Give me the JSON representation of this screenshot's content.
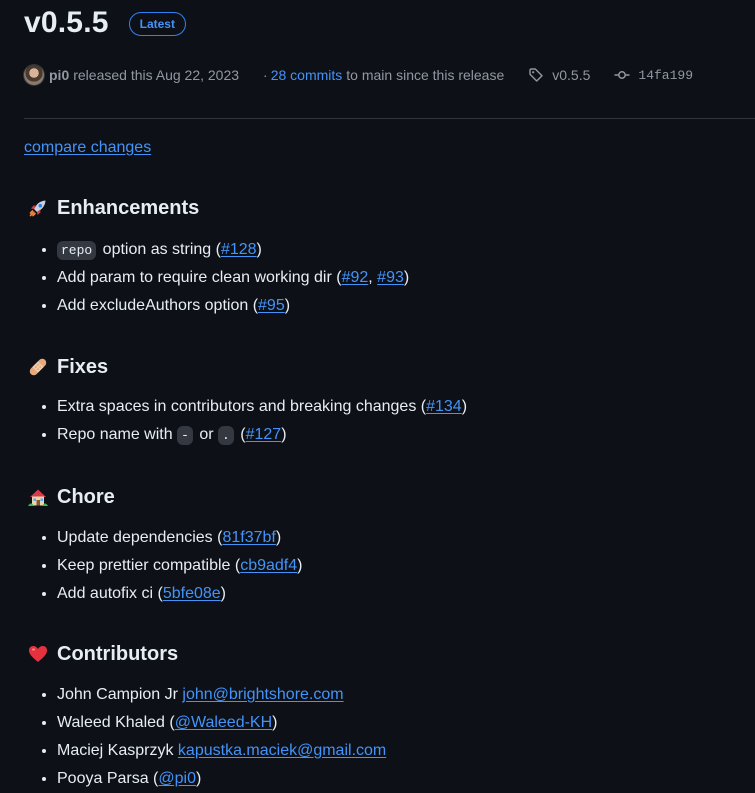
{
  "release": {
    "version": "v0.5.5",
    "badge": "Latest",
    "author": "pi0",
    "released_text": "released this Aug 22, 2023",
    "commits_sep": "·",
    "commits_link": "28 commits",
    "commits_suffix": "to main since this release",
    "tag": "v0.5.5",
    "commit_hash": "14fa199"
  },
  "body": {
    "compare_link": "compare changes",
    "sections": [
      {
        "title": "Enhancements",
        "icon": "rocket-icon",
        "items": [
          {
            "code": "repo",
            "text": " option as string (",
            "links": [
              "#128"
            ],
            "end": ")"
          },
          {
            "text": "Add param to require clean working dir (",
            "links": [
              "#92",
              "#93"
            ],
            "end": ")"
          },
          {
            "text": "Add excludeAuthors option (",
            "links": [
              "#95"
            ],
            "end": ")"
          }
        ]
      },
      {
        "title": "Fixes",
        "icon": "bandage-icon",
        "items": [
          {
            "text": "Extra spaces in contributors and breaking changes (",
            "links": [
              "#134"
            ],
            "end": ")"
          },
          {
            "text": "Repo name with ",
            "code1": "-",
            "mid": " or ",
            "code2": ".",
            "text2": " (",
            "links": [
              "#127"
            ],
            "end": ")"
          }
        ]
      },
      {
        "title": "Chore",
        "icon": "house-icon",
        "items": [
          {
            "text": "Update dependencies (",
            "links": [
              "81f37bf"
            ],
            "end": ")"
          },
          {
            "text": "Keep prettier compatible (",
            "links": [
              "cb9adf4"
            ],
            "end": ")"
          },
          {
            "text": "Add autofix ci (",
            "links": [
              "5bfe08e"
            ],
            "end": ")"
          }
        ]
      },
      {
        "title": "Contributors",
        "icon": "heart-icon",
        "items": [
          {
            "text": "John Campion Jr ",
            "links": [
              "john@brightshore.com"
            ],
            "end": ""
          },
          {
            "text": "Waleed Khaled (",
            "links": [
              "@Waleed-KH"
            ],
            "end": ")"
          },
          {
            "text": "Maciej Kasprzyk ",
            "links": [
              "kapustka.maciek@gmail.com"
            ],
            "end": ""
          },
          {
            "text": "Pooya Parsa (",
            "links": [
              "@pi0"
            ],
            "end": ")"
          }
        ]
      }
    ]
  },
  "colors": {
    "background": "#0d1117",
    "text": "#e6edf3",
    "muted": "#9198a1",
    "link": "#4493f8",
    "border": "#30363d",
    "code_bg": "#343941"
  }
}
